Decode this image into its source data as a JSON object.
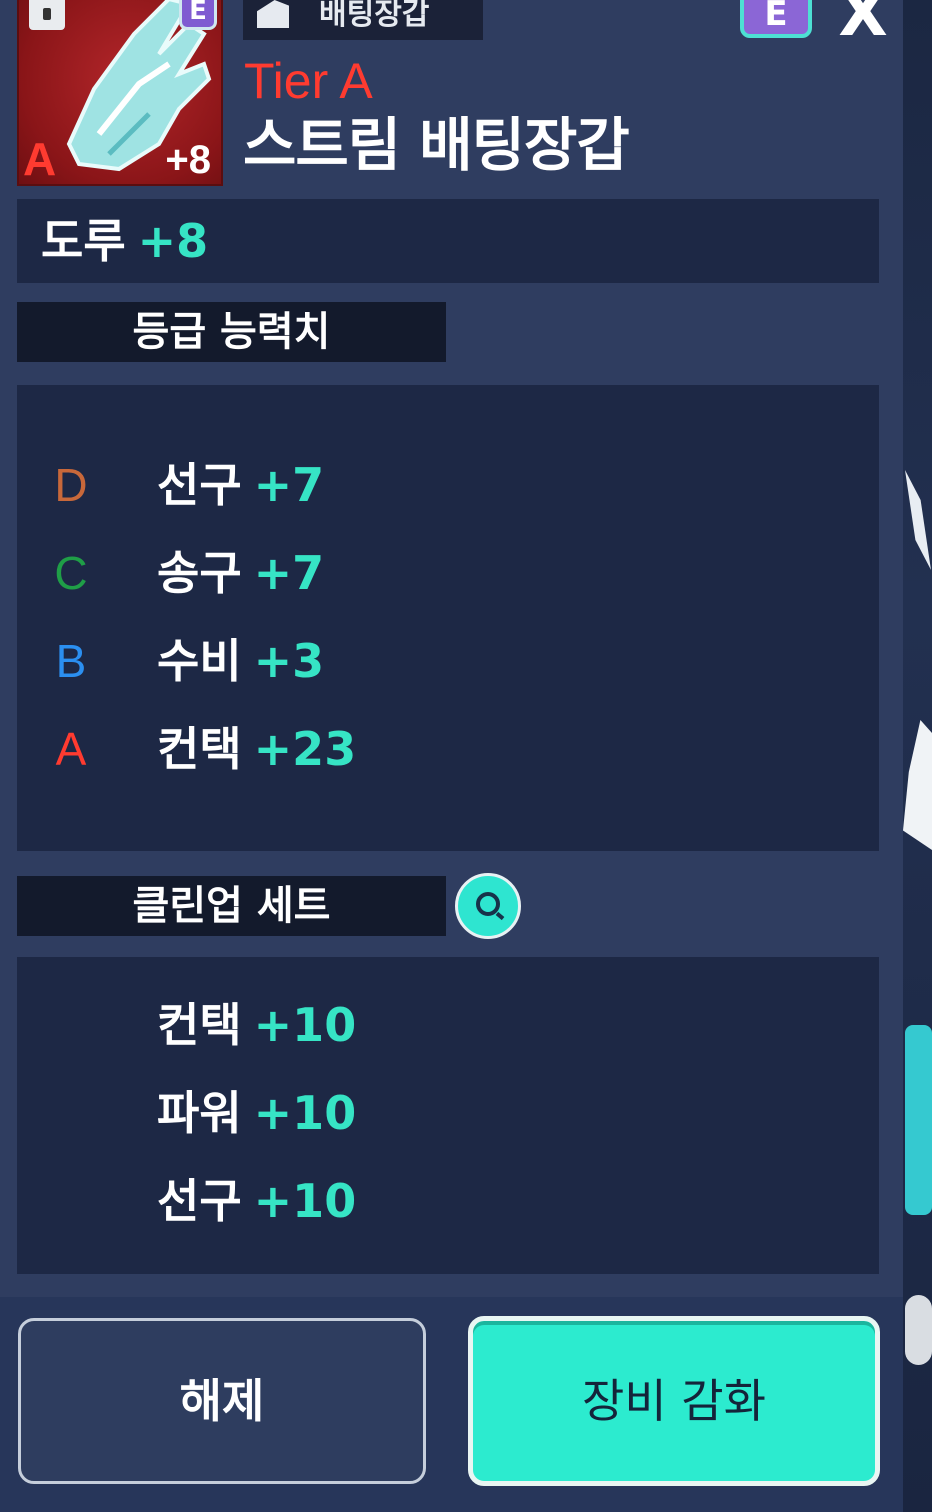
{
  "header": {
    "category": "배팅장갑",
    "tier": "Tier A",
    "item_name": "스트림 배팅장갑",
    "badge_letter": "E",
    "close_symbol": "X"
  },
  "thumbnail": {
    "tier_letter": "A",
    "level": "+8",
    "badge_letter": "E",
    "background_color": "#9e1c20"
  },
  "main_stat": {
    "name": "도루",
    "value": "+8"
  },
  "grade_section": {
    "title": "등급 능력치",
    "rows": [
      {
        "grade": "D",
        "grade_color": "#c8683a",
        "stat": "선구",
        "value": "+7"
      },
      {
        "grade": "C",
        "grade_color": "#1f9e47",
        "stat": "송구",
        "value": "+7"
      },
      {
        "grade": "B",
        "grade_color": "#2b8ff0",
        "stat": "수비",
        "value": "+3"
      },
      {
        "grade": "A",
        "grade_color": "#ff3b30",
        "stat": "컨택",
        "value": "+23"
      }
    ]
  },
  "set_section": {
    "title": "클린업 세트",
    "info_icon": "search-icon",
    "rows": [
      {
        "stat": "컨택",
        "value": "+10"
      },
      {
        "stat": "파워",
        "value": "+10"
      },
      {
        "stat": "선구",
        "value": "+10"
      }
    ]
  },
  "actions": {
    "release_label": "해제",
    "upgrade_label": "장비 감화"
  },
  "colors": {
    "accent": "#2cebcf",
    "stat_value": "#36e4c5",
    "panel": "#1d2845",
    "background": "#2f3d60"
  }
}
